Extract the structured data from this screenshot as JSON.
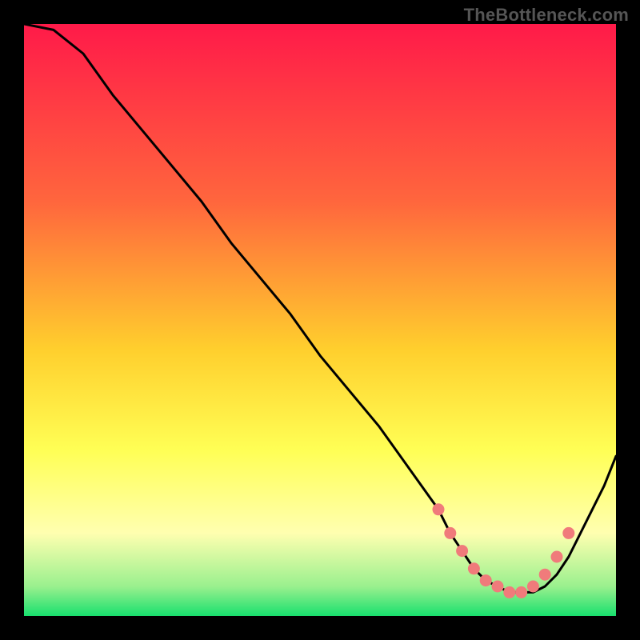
{
  "watermark": "TheBottleneck.com",
  "colors": {
    "top": "#ff1a49",
    "mid_upper": "#ff7a3a",
    "mid": "#ffd92a",
    "mid_lower": "#ffff55",
    "pale_yellow": "#ffffa8",
    "green": "#18e06e",
    "dot": "#f07b7b",
    "line": "#000000",
    "frame": "#000000"
  },
  "chart_data": {
    "type": "line",
    "title": "",
    "xlabel": "",
    "ylabel": "",
    "xlim": [
      0,
      100
    ],
    "ylim": [
      0,
      100
    ],
    "x": [
      0,
      5,
      10,
      15,
      20,
      25,
      30,
      35,
      40,
      45,
      50,
      55,
      60,
      65,
      70,
      72,
      74,
      76,
      78,
      80,
      82,
      84,
      86,
      88,
      90,
      92,
      94,
      96,
      98,
      100
    ],
    "values": [
      100,
      99,
      95,
      88,
      82,
      76,
      70,
      63,
      57,
      51,
      44,
      38,
      32,
      25,
      18,
      14,
      11,
      8,
      6,
      5,
      4,
      4,
      4,
      5,
      7,
      10,
      14,
      18,
      22,
      27
    ],
    "marked_points_x": [
      70,
      72,
      74,
      76,
      78,
      80,
      82,
      84,
      86,
      88,
      90,
      92
    ],
    "marked_points_y": [
      18,
      14,
      11,
      8,
      6,
      5,
      4,
      4,
      5,
      7,
      10,
      14
    ],
    "gradient_stops": [
      {
        "offset": 0.0,
        "color": "#ff1a49"
      },
      {
        "offset": 0.3,
        "color": "#ff663d"
      },
      {
        "offset": 0.55,
        "color": "#ffcf2d"
      },
      {
        "offset": 0.72,
        "color": "#ffff55"
      },
      {
        "offset": 0.86,
        "color": "#ffffb0"
      },
      {
        "offset": 0.95,
        "color": "#9af08e"
      },
      {
        "offset": 1.0,
        "color": "#18e06e"
      }
    ]
  }
}
